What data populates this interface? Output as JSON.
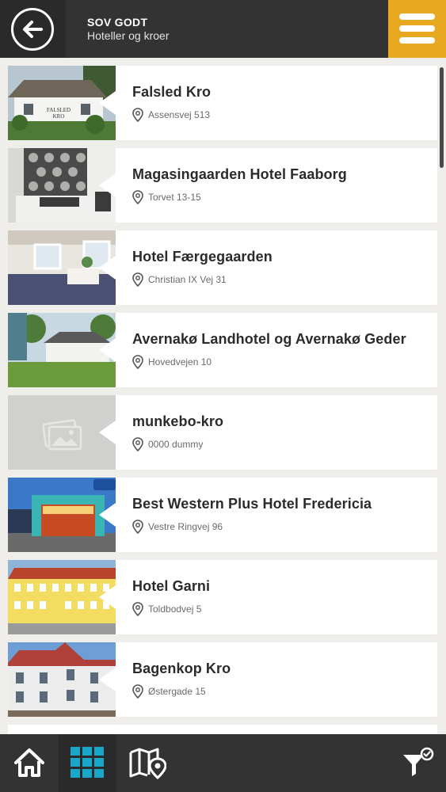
{
  "header": {
    "title": "SOV GODT",
    "subtitle": "Hoteller og kroer",
    "back_icon": "arrow-left-icon",
    "menu_icon": "hamburger-menu-icon",
    "accent_color": "#e8a81f"
  },
  "hotels": [
    {
      "name": "Falsled Kro",
      "address": "Assensvej 513"
    },
    {
      "name": "Magasingaarden Hotel Faaborg",
      "address": "Torvet 13-15"
    },
    {
      "name": "Hotel Færgegaarden",
      "address": "Christian IX Vej 31"
    },
    {
      "name": "Avernakø Landhotel og Avernakø Geder",
      "address": "Hovedvejen 10"
    },
    {
      "name": "munkebo-kro",
      "address": "0000 dummy"
    },
    {
      "name": "Best Western Plus Hotel Fredericia",
      "address": "Vestre Ringvej 96"
    },
    {
      "name": "Hotel Garni",
      "address": "Toldbodvej 5"
    },
    {
      "name": "Bagenkop Kro",
      "address": "Østergade 15"
    }
  ],
  "bottom_nav": {
    "items": [
      "home-icon",
      "grid-icon",
      "map-pin-icon",
      "filter-icon"
    ],
    "active": "grid-icon",
    "active_color": "#1aa6c8"
  }
}
